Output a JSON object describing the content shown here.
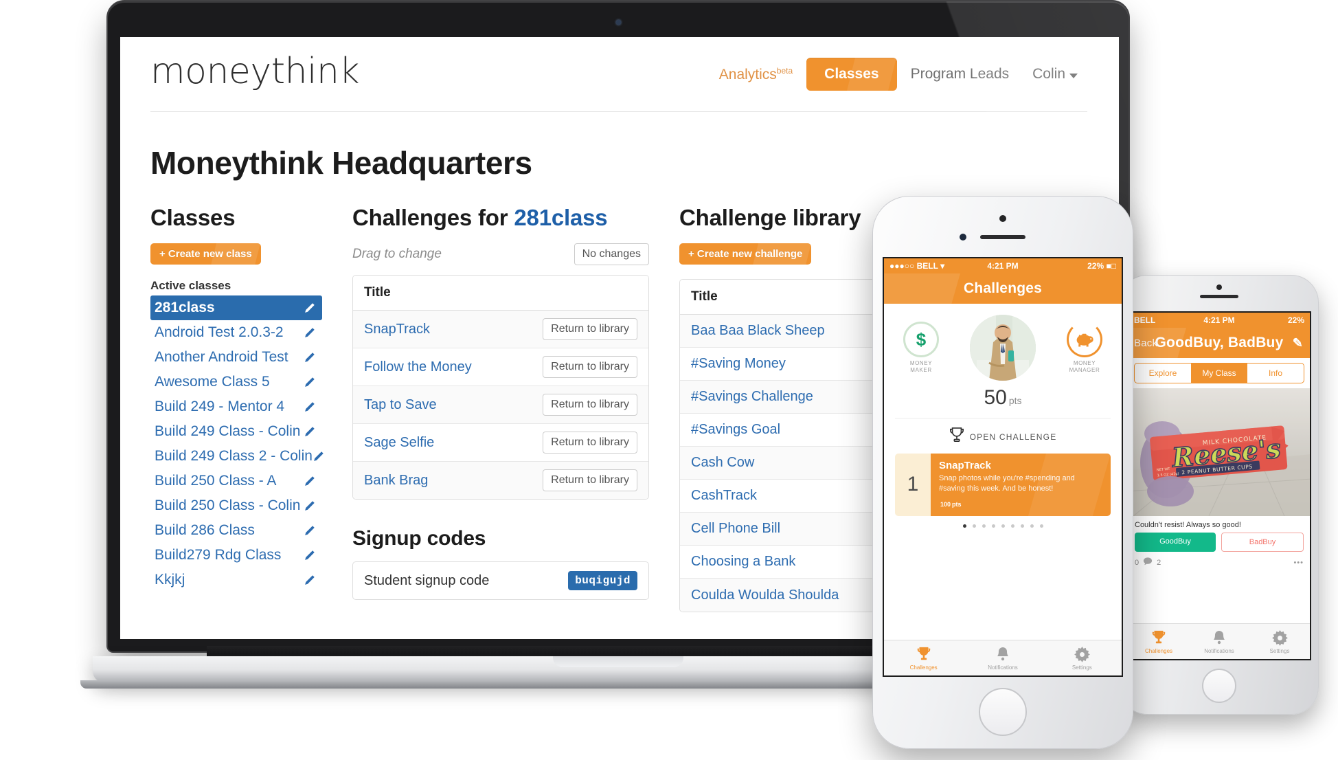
{
  "web": {
    "logo": "moneythink",
    "nav": {
      "analytics": "Analytics",
      "analytics_sup": "beta",
      "classes": "Classes",
      "program_leads": "Program Leads",
      "user": "Colin"
    },
    "page_title": "Moneythink Headquarters",
    "classes_panel": {
      "heading": "Classes",
      "create_button": "+ Create new class",
      "list_label": "Active classes",
      "items": [
        {
          "name": "281class",
          "active": true
        },
        {
          "name": "Android Test 2.0.3-2",
          "active": false
        },
        {
          "name": "Another Android Test",
          "active": false
        },
        {
          "name": "Awesome Class 5",
          "active": false
        },
        {
          "name": "Build 249 - Mentor 4",
          "active": false
        },
        {
          "name": "Build 249 Class - Colin",
          "active": false
        },
        {
          "name": "Build 249 Class 2 - Colin",
          "active": false
        },
        {
          "name": "Build 250 Class - A",
          "active": false
        },
        {
          "name": "Build 250 Class - Colin",
          "active": false
        },
        {
          "name": "Build 286 Class",
          "active": false
        },
        {
          "name": "Build279 Rdg Class",
          "active": false
        },
        {
          "name": "Kkjkj",
          "active": false
        }
      ]
    },
    "challenges_panel": {
      "heading_prefix": "Challenges for ",
      "heading_class": "281class",
      "drag_hint": "Drag to change",
      "changes_button": "No changes",
      "column_title": "Title",
      "rows": [
        {
          "title": "SnapTrack",
          "action": "Return to library"
        },
        {
          "title": "Follow the Money",
          "action": "Return to library"
        },
        {
          "title": "Tap to Save",
          "action": "Return to library"
        },
        {
          "title": "Sage Selfie",
          "action": "Return to library"
        },
        {
          "title": "Bank Brag",
          "action": "Return to library"
        }
      ],
      "signup_heading": "Signup codes",
      "signup_label": "Student signup code",
      "signup_code": "buqigujd"
    },
    "library_panel": {
      "heading": "Challenge library",
      "create_button": "+ Create new challenge",
      "column_title": "Title",
      "rows": [
        "Baa Baa Black Sheep",
        "#Saving Money",
        "#Savings Challenge",
        "#Savings Goal",
        "Cash Cow",
        "CashTrack",
        "Cell Phone Bill",
        "Choosing a Bank",
        "Coulda Woulda Shoulda"
      ]
    }
  },
  "phone_front": {
    "status": {
      "carrier": "BELL",
      "signal": "●●●○○",
      "time": "4:21 PM",
      "battery": "22%"
    },
    "title": "Challenges",
    "badge_left": {
      "symbol": "$",
      "line1": "MONEY",
      "line2": "MAKER"
    },
    "badge_right": {
      "line1": "MONEY",
      "line2": "MANAGER"
    },
    "points": {
      "value": "50",
      "unit": "pts"
    },
    "open_challenge_label": "OPEN CHALLENGE",
    "card": {
      "number": "1",
      "title": "SnapTrack",
      "description": "Snap photos while you're #spending and #saving this week. And be honest!",
      "points": "100",
      "points_unit": "pts"
    },
    "dots_total": 9,
    "dots_active": 0,
    "tabs": [
      {
        "label": "Challenges",
        "icon": "trophy-icon",
        "active": true
      },
      {
        "label": "Notifications",
        "icon": "bell-icon",
        "active": false
      },
      {
        "label": "Settings",
        "icon": "gear-icon",
        "active": false
      }
    ]
  },
  "phone_back": {
    "status": {
      "carrier": "BELL",
      "time": "4:21 PM",
      "battery": "22%"
    },
    "back_label": "Back",
    "title": "GoodBuy, BadBuy",
    "segments": [
      {
        "label": "Explore",
        "active": false
      },
      {
        "label": "My Class",
        "active": true
      },
      {
        "label": "Info",
        "active": false
      }
    ],
    "post": {
      "caption": "Couldn't resist! Always so good!",
      "good_label": "GoodBuy",
      "bad_label": "BadBuy",
      "like_count": "0",
      "comment_count": "2",
      "more": "•••"
    },
    "tabs": [
      {
        "label": "Challenges",
        "icon": "trophy-icon",
        "active": true
      },
      {
        "label": "Notifications",
        "icon": "bell-icon",
        "active": false
      },
      {
        "label": "Settings",
        "icon": "gear-icon",
        "active": false
      }
    ]
  },
  "colors": {
    "brand_orange": "#f0922e",
    "link_blue": "#2d6cb0",
    "selected_blue": "#2a6cad",
    "good_green": "#13b98a",
    "bad_red": "#f3736a"
  }
}
